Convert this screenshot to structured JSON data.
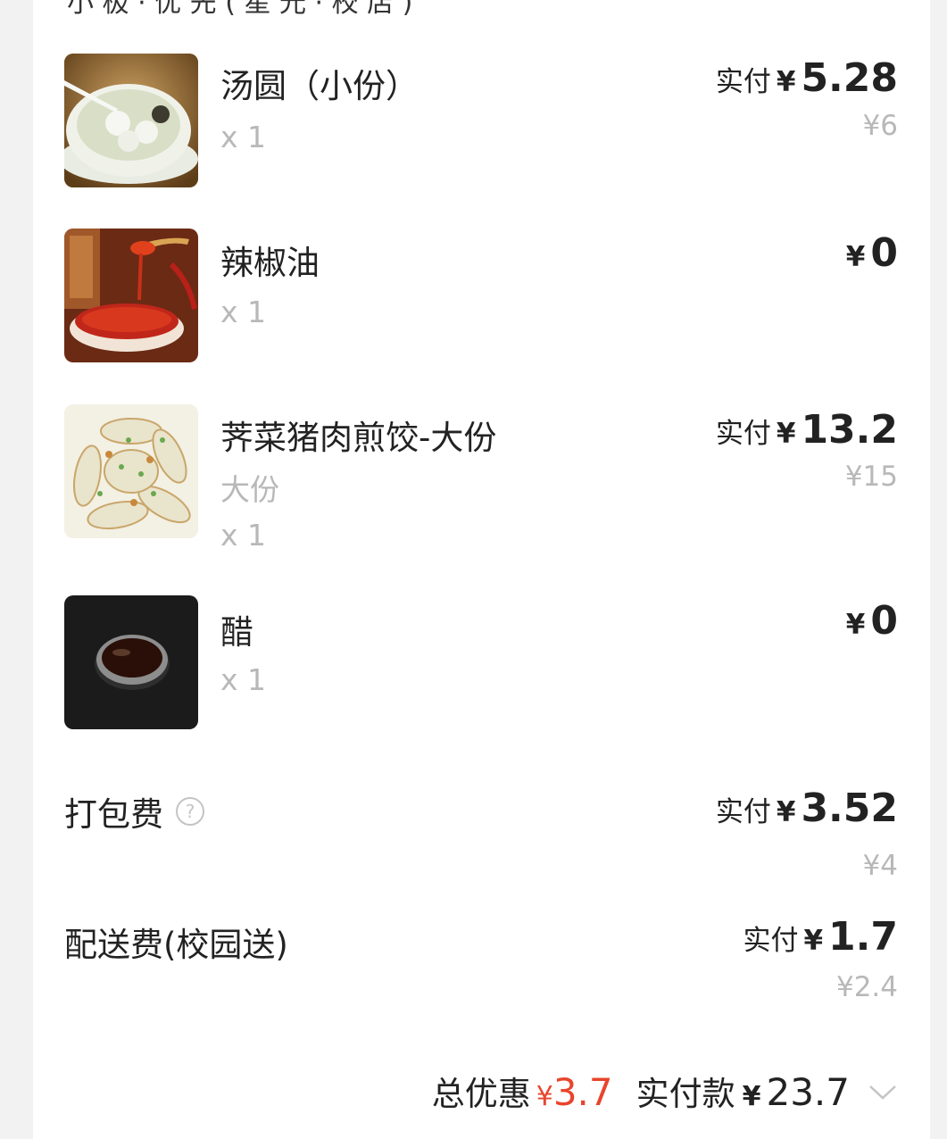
{
  "header": {
    "partial_text": "小 极 · 优 先 ( 星 光 · 校 店 )"
  },
  "items": [
    {
      "name": "汤圆（小份）",
      "spec": "",
      "qty": "x 1",
      "pay_label": "实付",
      "currency": "¥",
      "paid": "5.28",
      "original": "¥6",
      "image_icon": "tangyuan-image"
    },
    {
      "name": "辣椒油",
      "spec": "",
      "qty": "x 1",
      "pay_label": "",
      "currency": "¥",
      "paid": "0",
      "original": "",
      "image_icon": "chili-oil-image"
    },
    {
      "name": "荠菜猪肉煎饺-大份",
      "spec": "大份",
      "qty": "x 1",
      "pay_label": "实付",
      "currency": "¥",
      "paid": "13.2",
      "original": "¥15",
      "image_icon": "dumplings-image"
    },
    {
      "name": "醋",
      "spec": "",
      "qty": "x 1",
      "pay_label": "",
      "currency": "¥",
      "paid": "0",
      "original": "",
      "image_icon": "vinegar-image"
    }
  ],
  "fees": {
    "packing": {
      "label": "打包费",
      "help_icon": "question-circle-icon",
      "help_glyph": "?",
      "pay_label": "实付",
      "currency": "¥",
      "paid": "3.52",
      "original": "¥4"
    },
    "delivery": {
      "label": "配送费(校园送)",
      "pay_label": "实付",
      "currency": "¥",
      "paid": "1.7",
      "original": "¥2.4"
    }
  },
  "footer": {
    "discount_label": "总优惠",
    "discount_currency": "¥",
    "discount_amount": "3.7",
    "total_label": "实付款",
    "total_currency": "¥",
    "total_amount": "23.7",
    "expand_icon": "chevron-down-icon"
  },
  "colors": {
    "accent_red": "#e8452c",
    "muted_gray": "#b8b8b8",
    "text": "#222222",
    "background": "#f2f2f2"
  }
}
